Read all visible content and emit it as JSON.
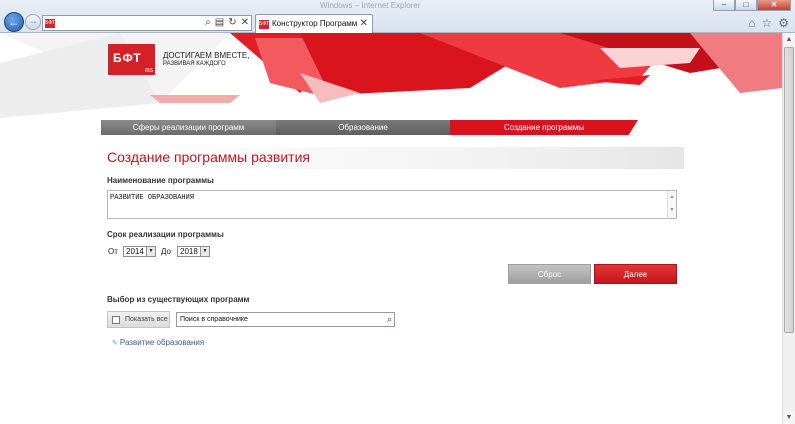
{
  "browser": {
    "window_title": "Windows – Internet Explorer",
    "address_favicon": "БФТ",
    "tab_title": "Конструктор Программ",
    "tab_favicon": "БФТ",
    "back_icon": "←",
    "forward_icon": "→"
  },
  "header": {
    "logo_text": "БФТ",
    "logo_sub": "IBS",
    "slogan_line1": "ДОСТИГАЕМ ВМЕСТЕ,",
    "slogan_line2": "РАЗВИВАЯ КАЖДОГО",
    "accent_color": "#d42127"
  },
  "steps": [
    {
      "label": "Сферы реализации программ",
      "active": false
    },
    {
      "label": "Образование",
      "active": false
    },
    {
      "label": "Создание программы",
      "active": true
    }
  ],
  "form": {
    "page_title": "Создание программы развития",
    "name_label": "Наименование программы",
    "name_value": "РАЗВИТИЕ ОБРАЗОВАНИЯ",
    "period_label": "Срок реализации программы",
    "from_label": "От",
    "from_value": "2014",
    "to_label": "До",
    "to_value": "2018",
    "reset_label": "Сброс",
    "next_label": "Далее"
  },
  "existing": {
    "label": "Выбор из существующих программ",
    "show_all_label": "Показать все",
    "search_value": "Поиск в справочнике",
    "items": [
      "Развитие образования"
    ]
  }
}
